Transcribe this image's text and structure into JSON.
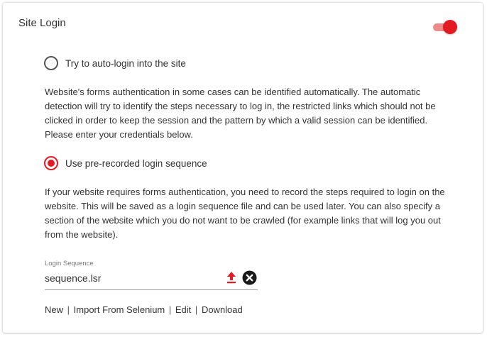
{
  "section": {
    "title": "Site Login",
    "enabled": true
  },
  "options": {
    "auto_login": {
      "label": "Try to auto-login into the site",
      "selected": false,
      "description": "Website's forms authentication in some cases can be identified automatically. The automatic detection will try to identify the steps necessary to log in, the restricted links which should not be clicked in order to keep the session and the pattern by which a valid session can be identified. Please enter your credentials below."
    },
    "prerecorded": {
      "label": "Use pre-recorded login sequence",
      "selected": true,
      "description": "If your website requires forms authentication, you need to record the steps required to login on the website. This will be saved as a login sequence file and can be used later. You can also specify a section of the website which you do not want to be crawled (for example links that will log you out from the website)."
    }
  },
  "login_sequence": {
    "label": "Login Sequence",
    "value": "sequence.lsr"
  },
  "actions": {
    "new": "New",
    "import": "Import From Selenium",
    "edit": "Edit",
    "download": "Download",
    "separator": "|"
  },
  "colors": {
    "accent": "#e21b23",
    "toggle_track": "#f08a8a",
    "text": "#333333"
  },
  "icons": {
    "upload": "upload-arrow-icon",
    "clear": "close-circle-icon"
  }
}
